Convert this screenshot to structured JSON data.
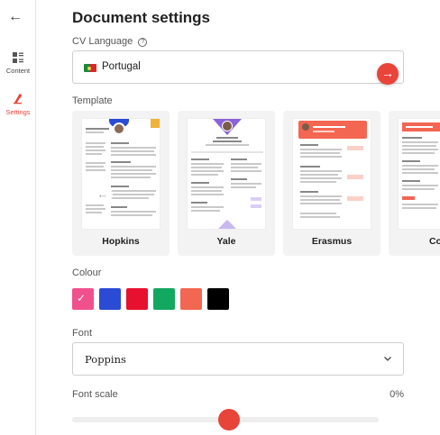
{
  "sidebar": {
    "items": [
      {
        "label": "Content",
        "icon": "content-icon"
      },
      {
        "label": "Settings",
        "icon": "settings-icon"
      }
    ]
  },
  "page": {
    "title": "Document settings"
  },
  "cv_language": {
    "label": "CV Language",
    "value": "Portugal"
  },
  "template": {
    "label": "Template",
    "items": [
      {
        "name": "Hopkins"
      },
      {
        "name": "Yale"
      },
      {
        "name": "Erasmus"
      },
      {
        "name": "Cor"
      }
    ]
  },
  "colour": {
    "label": "Colour",
    "swatches": [
      "#f0508c",
      "#2a4bd3",
      "#e8102f",
      "#13a860",
      "#f26652",
      "#000000"
    ],
    "selected": 0
  },
  "font": {
    "label": "Font",
    "value": "Poppins"
  },
  "font_scale": {
    "label": "Font scale",
    "value": "0%",
    "level": 0.5
  },
  "accent": "#e8443a"
}
